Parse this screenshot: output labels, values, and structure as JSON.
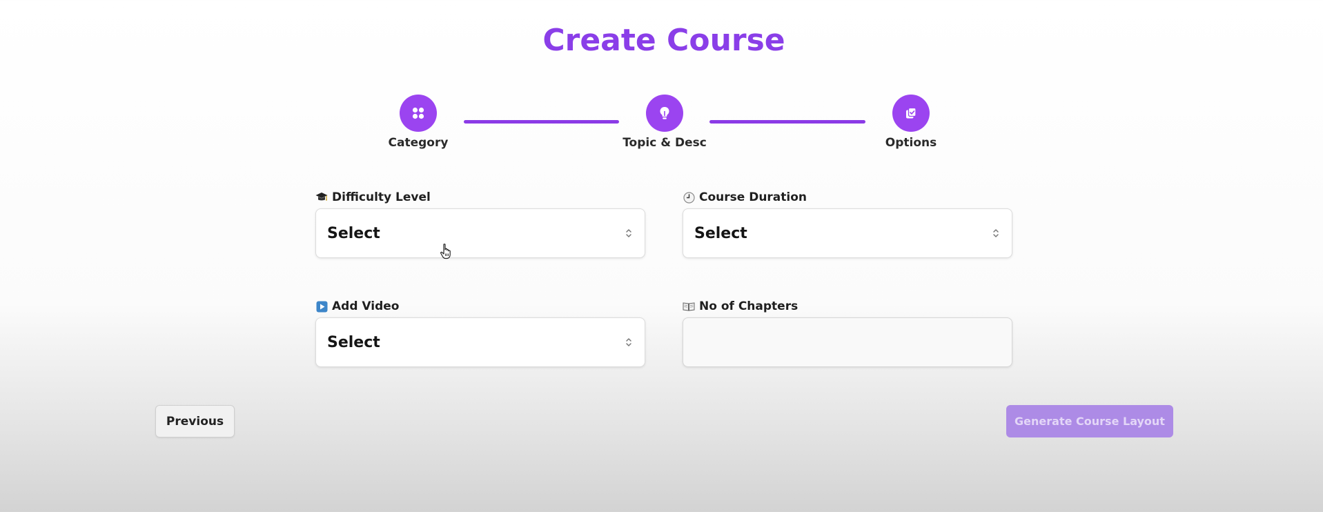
{
  "page": {
    "title": "Create Course",
    "accent_color": "#8a3ee8",
    "step_color": "#9b44f0"
  },
  "stepper": {
    "steps": [
      {
        "label": "Category",
        "icon": "grid-icon"
      },
      {
        "label": "Topic & Desc",
        "icon": "lightbulb-icon"
      },
      {
        "label": "Options",
        "icon": "clipboard-check-icon"
      }
    ]
  },
  "form": {
    "difficulty": {
      "label": "Difficulty Level",
      "icon": "graduation-cap-icon",
      "value": "Select"
    },
    "duration": {
      "label": "Course Duration",
      "icon": "clock-icon",
      "value": "Select"
    },
    "video": {
      "label": "Add Video",
      "icon": "play-button-icon",
      "value": "Select"
    },
    "chapters": {
      "label": "No of Chapters",
      "icon": "open-book-icon",
      "value": ""
    }
  },
  "buttons": {
    "previous": "Previous",
    "generate": "Generate Course Layout",
    "generate_color": "#ad8be6"
  }
}
